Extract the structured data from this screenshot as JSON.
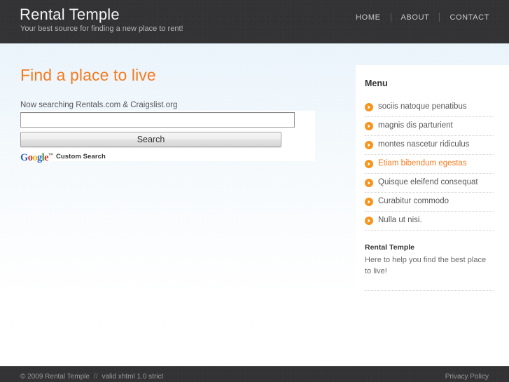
{
  "header": {
    "title": "Rental Temple",
    "tagline": "Your best source for finding a new place to rent!",
    "nav": [
      {
        "label": "HOME"
      },
      {
        "label": "ABOUT"
      },
      {
        "label": "CONTACT"
      }
    ]
  },
  "main": {
    "heading": "Find a place to live",
    "search_note": "Now searching Rentals.com & Craigslist.org",
    "search": {
      "value": "",
      "placeholder": "",
      "button_label": "Search",
      "branding_text": "Custom Search",
      "logo_letters": [
        "G",
        "o",
        "o",
        "g",
        "l",
        "e"
      ],
      "trademark": "™"
    }
  },
  "sidebar": {
    "heading": "Menu",
    "items": [
      {
        "label": "sociis natoque penatibus",
        "active": false
      },
      {
        "label": "magnis dis parturient",
        "active": false
      },
      {
        "label": "montes nascetur ridiculus",
        "active": false
      },
      {
        "label": "Etiam bibendum egestas",
        "active": true
      },
      {
        "label": "Quisque eleifend consequat",
        "active": false
      },
      {
        "label": "Curabitur commodo",
        "active": false
      },
      {
        "label": "Nulla ut nisi.",
        "active": false
      }
    ],
    "block": {
      "title": "Rental Temple",
      "text": "Here to help you find the best place to live!"
    }
  },
  "footer": {
    "copyright": "© 2009 Rental Temple",
    "separator": "//",
    "validator": "valid xhtml 1.0 strict",
    "privacy": "Privacy Policy"
  },
  "colors": {
    "accent": "#f47b20",
    "header_bg": "#333335",
    "text": "#58585a",
    "page_bg": "#eaf4fb"
  }
}
